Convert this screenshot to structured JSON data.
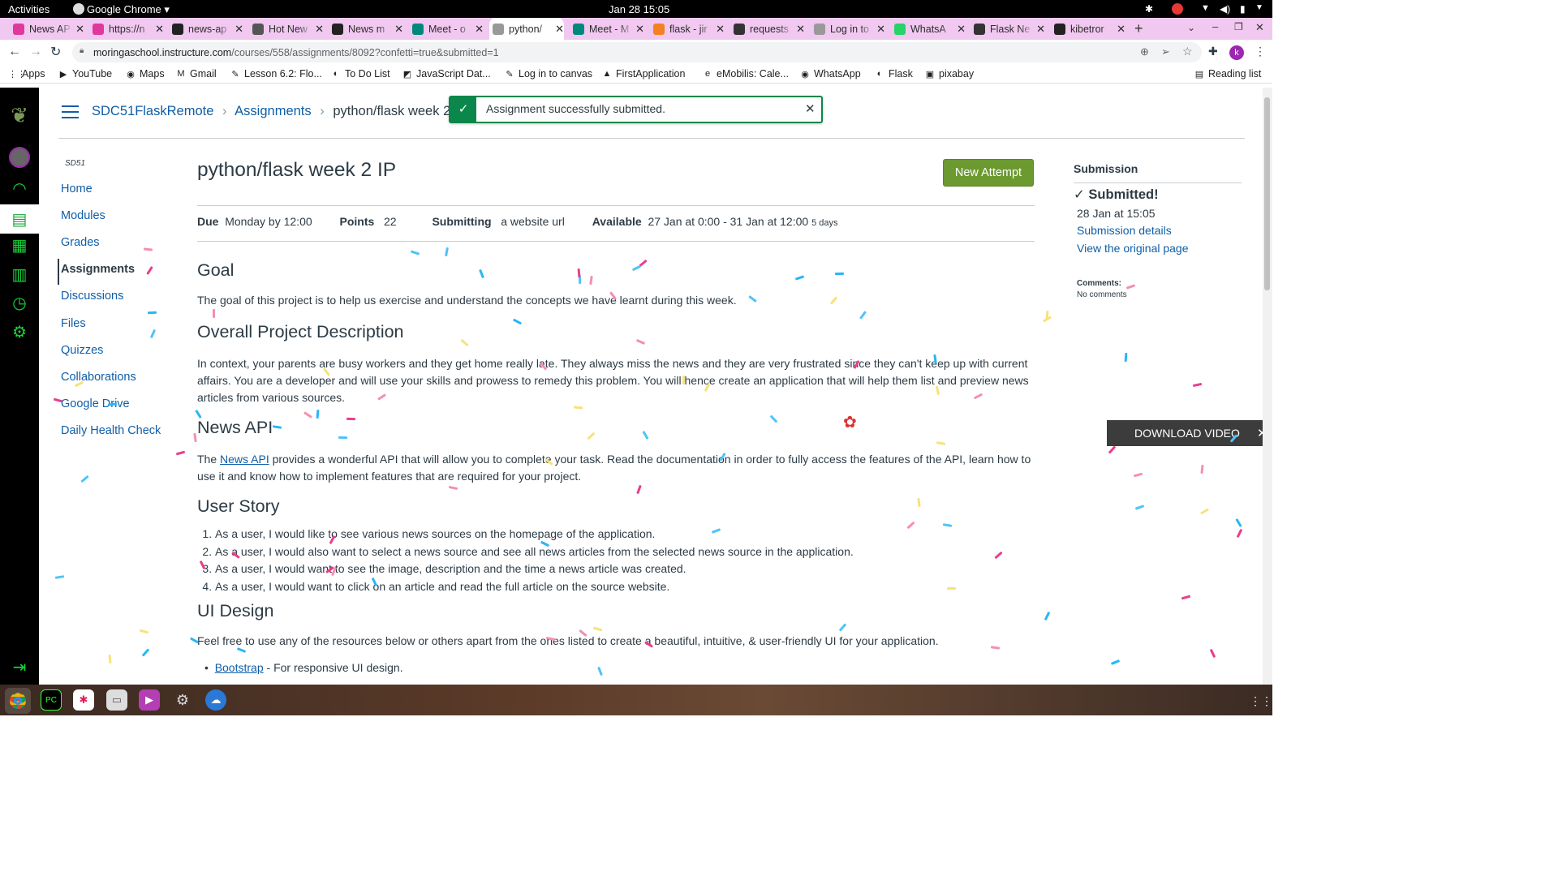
{
  "topbar": {
    "activities": "Activities",
    "app": "Google Chrome",
    "clock": "Jan 28  15:05"
  },
  "tabs": [
    {
      "label": "News AP",
      "icon": "canvas-icon",
      "color": "#e0389c"
    },
    {
      "label": "https://n",
      "icon": "canvas-icon",
      "color": "#e0389c"
    },
    {
      "label": "news-ap",
      "icon": "github-icon",
      "color": "#222"
    },
    {
      "label": "Hot New",
      "icon": "globe-icon",
      "color": "#555"
    },
    {
      "label": "News m",
      "icon": "wikipedia-icon",
      "color": "#222"
    },
    {
      "label": "Meet - o",
      "icon": "meet-icon",
      "color": "#00897b"
    },
    {
      "label": "python/",
      "icon": "canvas-leaf-icon",
      "color": "#999"
    },
    {
      "label": "Meet - M",
      "icon": "meet-icon",
      "color": "#00897b"
    },
    {
      "label": "flask - jir",
      "icon": "stackoverflow-icon",
      "color": "#f48024"
    },
    {
      "label": "requests",
      "icon": "terminal-icon",
      "color": "#333"
    },
    {
      "label": "Log in to",
      "icon": "canvas-leaf-icon",
      "color": "#999"
    },
    {
      "label": "WhatsA",
      "icon": "whatsapp-icon",
      "color": "#25d366"
    },
    {
      "label": "Flask Ne",
      "icon": "terminal-icon",
      "color": "#333"
    },
    {
      "label": "kibetror",
      "icon": "github-icon",
      "color": "#222"
    }
  ],
  "url": {
    "host": "moringaschool.instructure.com",
    "path": "/courses/558/assignments/8092?confetti=true&submitted=1"
  },
  "bookmarks": [
    "Apps",
    "YouTube",
    "Maps",
    "Gmail",
    "Lesson 6.2: Flo...",
    "To Do List",
    "JavaScript Dat...",
    "Log in to canvas",
    "FirstApplication",
    "eMobilis: Cale...",
    "WhatsApp",
    "Flask",
    "pixabay"
  ],
  "reading_list": "Reading list",
  "breadcrumb": {
    "course": "SDC51FlaskRemote",
    "section": "Assignments",
    "page": "python/flask week 2 IP"
  },
  "flash": "Assignment successfully submitted.",
  "course_code": "SD51",
  "course_nav": [
    "Home",
    "Modules",
    "Grades",
    "Assignments",
    "Discussions",
    "Files",
    "Quizzes",
    "Collaborations",
    "Google Drive",
    "Daily Health Check"
  ],
  "assignment": {
    "title": "python/flask week 2 IP",
    "new_attempt": "New Attempt",
    "due_label": "Due",
    "due": "Monday by 12:00",
    "points_label": "Points",
    "points": "22",
    "submitting_label": "Submitting",
    "submitting": "a website url",
    "available_label": "Available",
    "available": "27 Jan at 0:00 - 31 Jan at 12:00",
    "available_days": "5 days"
  },
  "body": {
    "goal_h": "Goal",
    "goal_p": "The goal of this project is to help us exercise and understand the concepts we have learnt during this week.",
    "desc_h": "Overall Project Description",
    "desc_p": "In context, your parents are busy workers and they get home really late. They always miss the news and they are very frustrated since they can't keep up with current affairs. You are a developer and will use your skills and prowess to remedy this problem. You will hence create an application that will help them list and preview news articles from various sources.",
    "api_h": "News API",
    "api_pre": "The ",
    "api_link": "News API",
    "api_post": " provides a wonderful API that will allow you to complete your task. Read the documentation in order to fully access the features of the API, learn how to use it and know how to implement features that are required for your project.",
    "story_h": "User Story",
    "stories": [
      "As a user, I would like to see various news sources on the homepage of the application.",
      "As a user, I would also want to select a news source and see all news articles from the selected news source in the application.",
      "As a user, I would want to see the image, description and the time a news article was created.",
      "As a user, I would want to click on an article and read the full article on the source website."
    ],
    "ui_h": "UI Design",
    "ui_p": "Feel free to use any of the resources below or others apart from the ones listed to create a beautiful, intuitive, & user-friendly UI for your application.",
    "res_link": "Bootstrap",
    "res_text": " - For responsive UI design."
  },
  "submission": {
    "heading": "Submission",
    "status": "Submitted!",
    "date": "28 Jan at 15:05",
    "details": "Submission details",
    "original": "View the original page",
    "comments_label": "Comments:",
    "comments": "No comments"
  },
  "download_video": "DOWNLOAD VIDEO"
}
